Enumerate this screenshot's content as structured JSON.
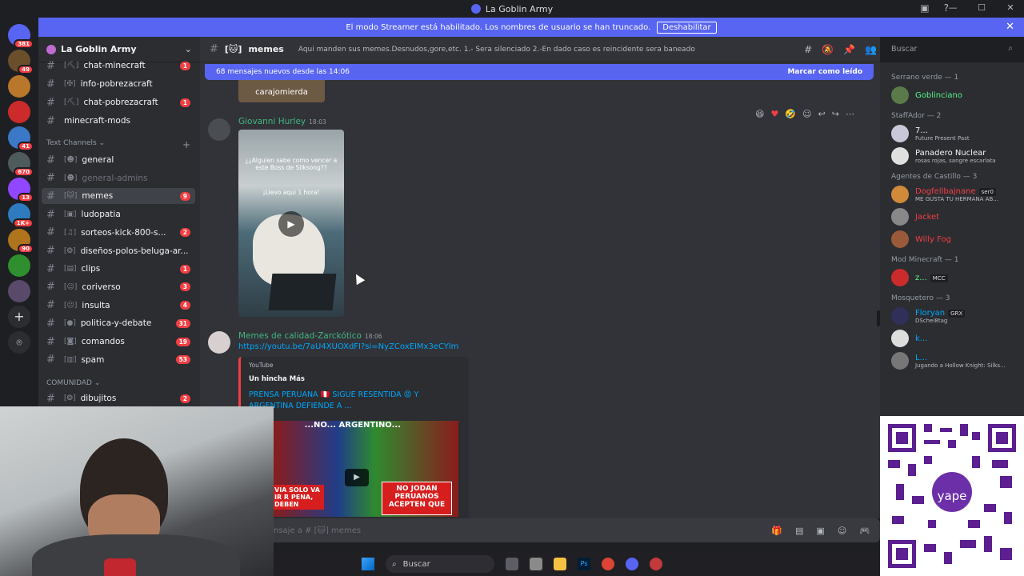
{
  "window": {
    "title": "La Goblin Army",
    "controls": [
      "—",
      "☐",
      "✕"
    ]
  },
  "banner": {
    "text": "El modo Streamer está habilitado. Los nombres de usuario se han truncado.",
    "button": "Deshabilitar"
  },
  "rail": {
    "servers": [
      {
        "badge": "381",
        "color": "#5865f2"
      },
      {
        "badge": "49",
        "color": "#6b4e2a"
      },
      {
        "badge": "",
        "color": "#b8772a"
      },
      {
        "badge": "",
        "color": "#cc2b2b"
      },
      {
        "badge": "41",
        "color": "#3b78c7"
      },
      {
        "badge": "670",
        "color": "#4f5a5c"
      },
      {
        "badge": "13",
        "color": "#9146ff"
      },
      {
        "badge": "1K+",
        "color": "#2e7bbf"
      },
      {
        "badge": "90",
        "color": "#b0741d"
      },
      {
        "badge": "",
        "color": "#2f8f2f"
      },
      {
        "badge": "",
        "color": "#5a4a6a"
      }
    ]
  },
  "sidebar": {
    "server_name": "La Goblin Army",
    "top_channels": [
      {
        "name": "chat-minecraft",
        "emoji": "[⛏]",
        "count": "1"
      },
      {
        "name": "info-pobrezacraft",
        "emoji": "[✠]",
        "count": ""
      },
      {
        "name": "chat-pobrezacraft",
        "emoji": "[⛏]",
        "count": "1"
      },
      {
        "name": "minecraft-mods",
        "emoji": "",
        "count": ""
      }
    ],
    "category_text": "Text Channels",
    "text_channels": [
      {
        "name": "general",
        "emoji": "[☻]",
        "count": "",
        "muted": false,
        "active": false
      },
      {
        "name": "general-admins",
        "emoji": "[☻]",
        "count": "",
        "muted": true,
        "active": false
      },
      {
        "name": "memes",
        "emoji": "[🐱]",
        "count": "9",
        "muted": false,
        "active": true
      },
      {
        "name": "ludopatia",
        "emoji": "[▣]",
        "count": "",
        "muted": false,
        "active": false
      },
      {
        "name": "sorteos-kick-800-s...",
        "emoji": "[♫]",
        "count": "2",
        "muted": false,
        "active": false
      },
      {
        "name": "diseños-polos-beluga-ar...",
        "emoji": "[❂]",
        "count": "",
        "muted": false,
        "active": false
      },
      {
        "name": "clips",
        "emoji": "[▤]",
        "count": "1",
        "muted": false,
        "active": false
      },
      {
        "name": "coriverso",
        "emoji": "[☺]",
        "count": "3",
        "muted": false,
        "active": false
      },
      {
        "name": "insulta",
        "emoji": "[☹]",
        "count": "4",
        "muted": false,
        "active": false
      },
      {
        "name": "politica-y-debate",
        "emoji": "[●]",
        "count": "31",
        "muted": false,
        "active": false
      },
      {
        "name": "comandos",
        "emoji": "[◙]",
        "count": "19",
        "muted": false,
        "active": false
      },
      {
        "name": "spam",
        "emoji": "[▥]",
        "count": "53",
        "muted": false,
        "active": false
      }
    ],
    "category_comunidad": "COMUNIDAD",
    "community_channels": [
      {
        "name": "dibujitos",
        "emoji": "[❂]",
        "count": "2"
      }
    ]
  },
  "chat_header": {
    "channel": "memes",
    "emoji": "[🐱]",
    "topic": "Aqui manden sus memes.Desnudos,gore,etc. 1.- Sera silenciado 2.-En dado caso es reincidente sera baneado"
  },
  "search": {
    "placeholder": "Buscar"
  },
  "chat": {
    "new_messages": "68 mensajes nuevos desde las 14:06",
    "mark_read": "Marcar como leído",
    "prev_image_caption": "carajomierda",
    "msg1": {
      "author": "Giovanni Hurley",
      "time": "18:03",
      "caption_top": "¿¿Alguien sabe como vencer a este Boss de Silksong??",
      "caption_mid": "¡Llevo aqui 1 hora!"
    },
    "msg2": {
      "author": "Memes de calidad-Zarckótico",
      "time": "18:06",
      "link": "https://youtu.be/7aU4XUOXdFI?si=NyZCoxEIMx3eCYlm",
      "embed_provider": "YouTube",
      "embed_author": "Un hincha Más",
      "embed_title": "PRENSA PERUANA 🇵🇪 SIGUE RESENTIDA 😡 Y ARGENTINA DEFIENDE A ...",
      "thumb_top": "...NO... ARGENTINO...",
      "thumb_left": "VIA SOLO VA IR R PENA, DEBEN",
      "thumb_right": "NO JODAN PERUANOS ACEPTEN QUE"
    }
  },
  "composer": {
    "placeholder": "nsaje a # [🐱] memes"
  },
  "members": {
    "groups": [
      {
        "title": "Serrano verde — 1",
        "members": [
          {
            "name": "Goblinciano",
            "status": "",
            "color": "#57f287",
            "tag": ""
          }
        ]
      },
      {
        "title": "StaffAdor — 2",
        "members": [
          {
            "name": "7...",
            "status": "Future Present Past",
            "color": "#f2f3f5",
            "tag": ""
          },
          {
            "name": "Panadero Nuclear",
            "status": "rosas rojas, sangre escarlata",
            "color": "#f2f3f5",
            "tag": ""
          }
        ]
      },
      {
        "title": "Agentes de Castillo — 3",
        "members": [
          {
            "name": "Dogfellbajnane",
            "status": "ME GUSTA TU HERMANA AB...",
            "color": "#f23f43",
            "tag": "ser0"
          },
          {
            "name": "Jacket",
            "status": "",
            "color": "#f23f43",
            "tag": ""
          },
          {
            "name": "Willy Fog",
            "status": "",
            "color": "#f23f43",
            "tag": ""
          }
        ]
      },
      {
        "title": "Mod Minecraft — 1",
        "members": [
          {
            "name": "z...",
            "status": "",
            "color": "#57f287",
            "tag": "MCC"
          }
        ]
      },
      {
        "title": "Mosquetero — 3",
        "members": [
          {
            "name": "Floryan",
            "status": "DSchei8tag",
            "color": "#00a8fc",
            "tag": "GRX"
          },
          {
            "name": "k...",
            "status": "",
            "color": "#00a8fc",
            "tag": ""
          },
          {
            "name": "L...",
            "status": "Jugando a Hollow Knight: Silks...",
            "color": "#00a8fc",
            "tag": ""
          }
        ]
      }
    ]
  },
  "taskbar": {
    "search": "Buscar"
  }
}
